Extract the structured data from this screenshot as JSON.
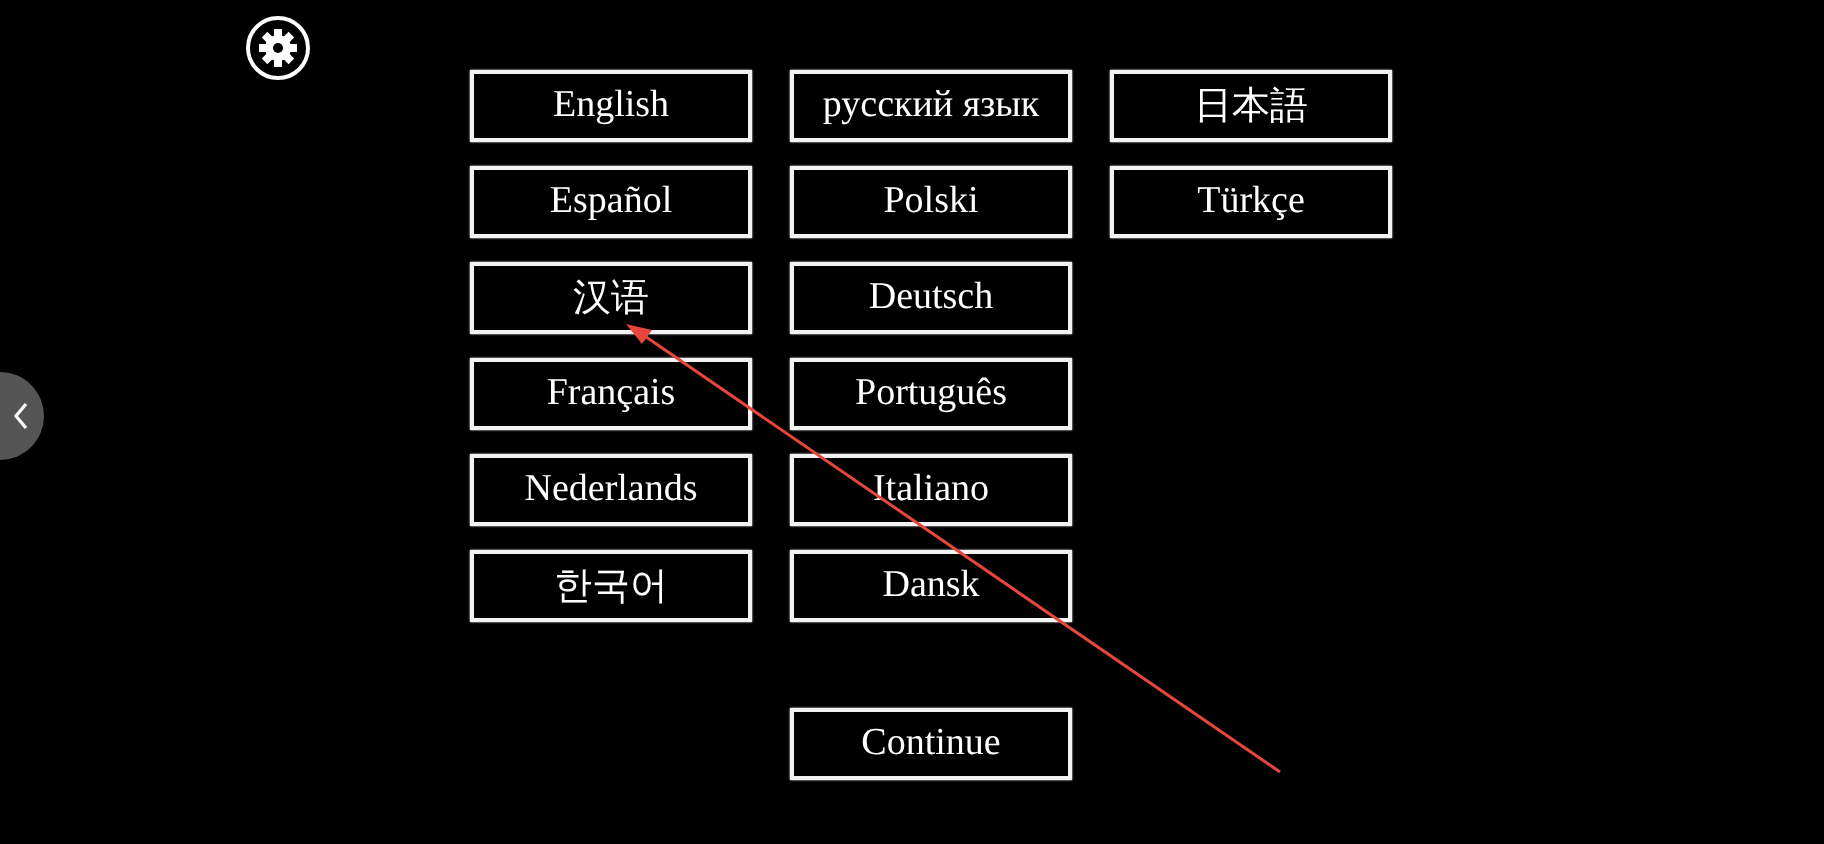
{
  "language_columns": [
    [
      "English",
      "Español",
      "汉语",
      "Français",
      "Nederlands",
      "한국어"
    ],
    [
      "русский язык",
      "Polski",
      "Deutsch",
      "Português",
      "Italiano",
      "Dansk"
    ],
    [
      "日本語",
      "Türkçe"
    ]
  ],
  "continue_button": "Continue"
}
